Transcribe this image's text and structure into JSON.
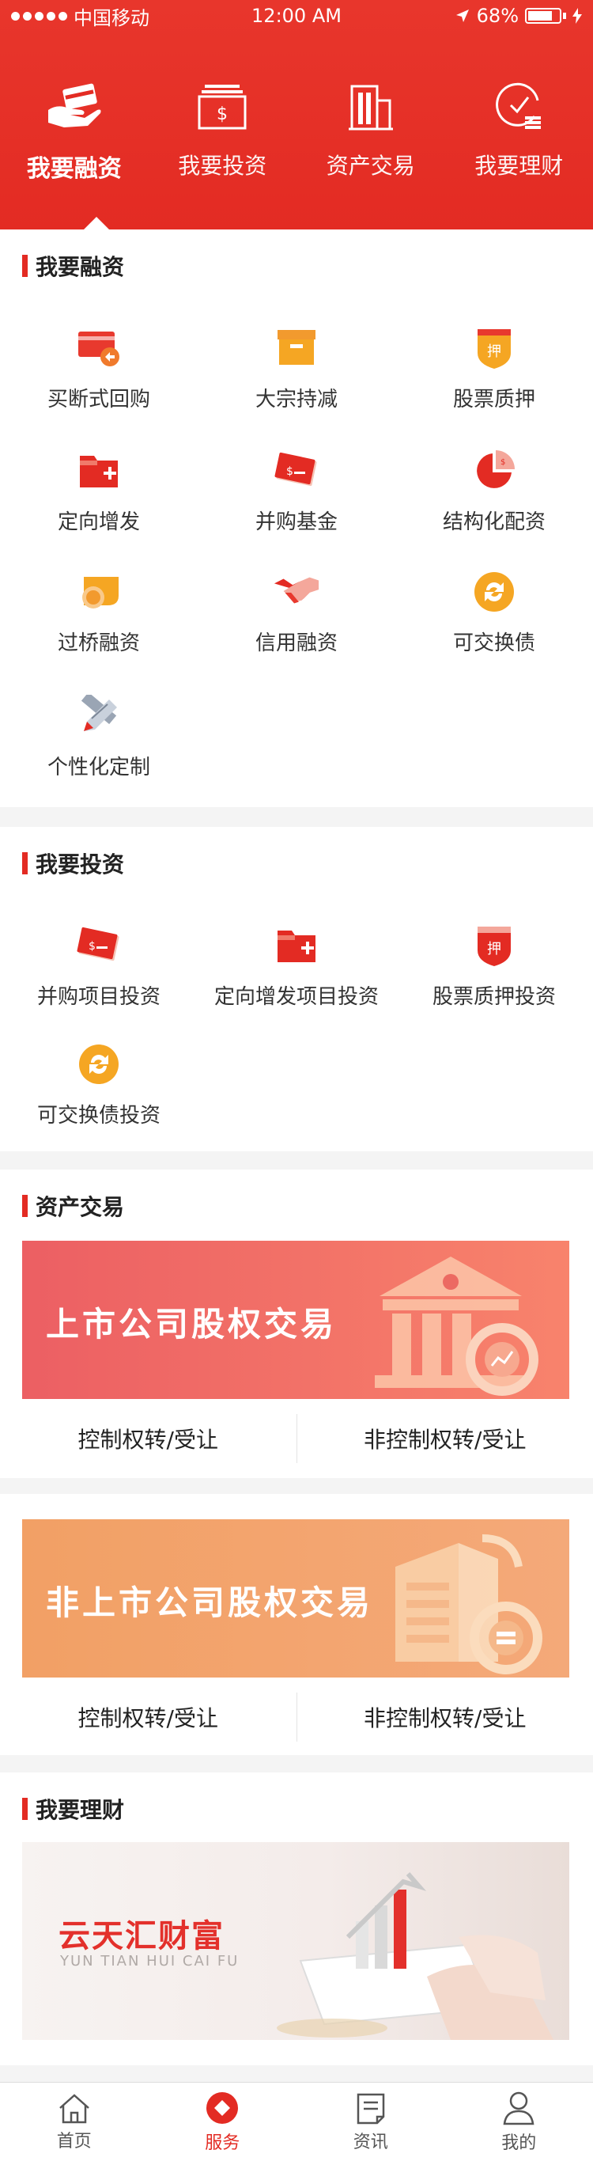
{
  "status_bar": {
    "carrier": "中国移动",
    "time": "12:00 AM",
    "battery": "68%"
  },
  "top_nav": [
    {
      "label": "我要融资",
      "icon": "hand-card-icon"
    },
    {
      "label": "我要投资",
      "icon": "money-stack-icon"
    },
    {
      "label": "资产交易",
      "icon": "building-icon"
    },
    {
      "label": "我要理财",
      "icon": "clock-coins-icon"
    }
  ],
  "financing": {
    "title": "我要融资",
    "items": [
      "买断式回购",
      "大宗持减",
      "股票质押",
      "定向增发",
      "并购基金",
      "结构化配资",
      "过桥融资",
      "信用融资",
      "可交换债",
      "个性化定制"
    ]
  },
  "investing": {
    "title": "我要投资",
    "items": [
      "并购项目投资",
      "定向增发项目投资",
      "股票质押投资",
      "可交换债投资"
    ]
  },
  "asset_trading": {
    "title": "资产交易",
    "listed": {
      "banner": "上市公司股权交易",
      "links": [
        "控制权转/受让",
        "非控制权转/受让"
      ]
    },
    "unlisted": {
      "banner": "非上市公司股权交易",
      "links": [
        "控制权转/受让",
        "非控制权转/受让"
      ]
    }
  },
  "wealth": {
    "title": "我要理财",
    "banner_title": "云天汇财富",
    "banner_sub": "YUN TIAN HUI CAI FU"
  },
  "tabbar": [
    {
      "label": "首页",
      "icon": "home-icon"
    },
    {
      "label": "服务",
      "icon": "service-icon"
    },
    {
      "label": "资讯",
      "icon": "news-icon"
    },
    {
      "label": "我的",
      "icon": "profile-icon"
    }
  ],
  "colors": {
    "brand": "#e32b23",
    "accent_orange": "#f5a623"
  }
}
